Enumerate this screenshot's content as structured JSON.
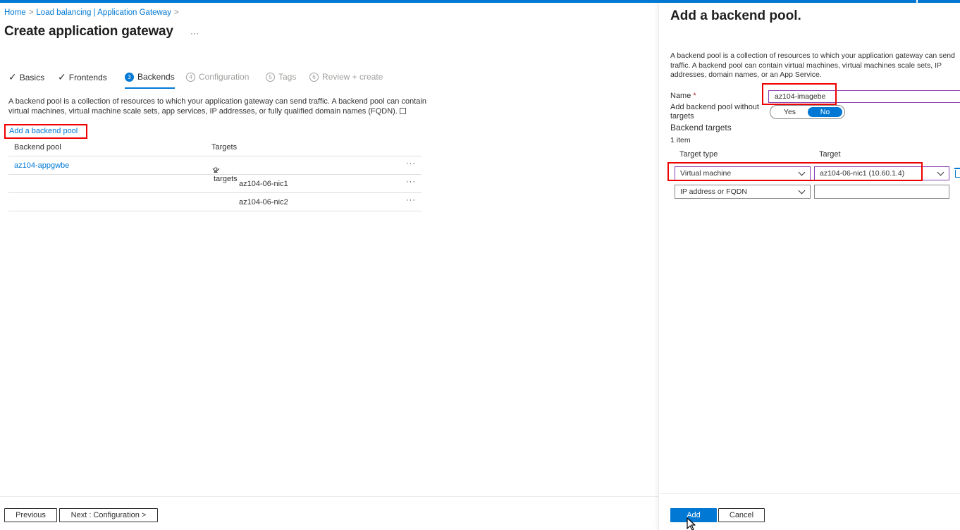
{
  "breadcrumb": {
    "home": "Home",
    "parent": "Load balancing | Application Gateway",
    "sep": ">"
  },
  "page": {
    "title": "Create application gateway",
    "more": "···"
  },
  "tabs": [
    {
      "label": "Basics",
      "state": "done"
    },
    {
      "label": "Frontends",
      "state": "done"
    },
    {
      "label": "Backends",
      "number": "3",
      "state": "active"
    },
    {
      "label": "Configuration",
      "number": "4",
      "state": "disabled"
    },
    {
      "label": "Tags",
      "number": "5",
      "state": "disabled"
    },
    {
      "label": "Review + create",
      "number": "6",
      "state": "disabled"
    }
  ],
  "main": {
    "description": "A backend pool is a collection of resources to which your application gateway can send traffic. A backend pool can contain virtual machines, virtual machine scale sets, app services, IP addresses, or fully qualified domain names (FQDN).",
    "add_pool_link": "Add a backend pool",
    "table": {
      "headers": [
        "Backend pool",
        "Targets"
      ],
      "rows": [
        {
          "pool": "az104-appgwbe",
          "targets": "2 targets"
        },
        {
          "pool": "",
          "targets": "az104-06-nic1"
        },
        {
          "pool": "",
          "targets": "az104-06-nic2"
        }
      ],
      "more_label": "···"
    }
  },
  "footer_left": {
    "previous": "Previous",
    "next": "Next : Configuration >"
  },
  "panel": {
    "title": "Add a backend pool.",
    "description": "A backend pool is a collection of resources to which your application gateway can send traffic. A backend pool can contain virtual machines, virtual machines scale sets, IP addresses, domain names, or an App Service.",
    "name_label": "Name",
    "required_mark": "*",
    "name_value": "az104-imagebe",
    "without_targets_label": "Add backend pool without targets",
    "toggle": {
      "yes": "Yes",
      "no": "No",
      "selected": "No"
    },
    "backend_targets_heading": "Backend targets",
    "item_count": "1 item",
    "col_target_type": "Target type",
    "col_target": "Target",
    "rows": [
      {
        "type": "Virtual machine",
        "target": "az104-06-nic1 (10.60.1.4)"
      },
      {
        "type": "IP address or FQDN",
        "target": ""
      }
    ]
  },
  "footer_right": {
    "add": "Add",
    "cancel": "Cancel"
  },
  "colors": {
    "accent": "#0078d4",
    "highlight": "#ee0000",
    "focus": "#8a3fb0"
  }
}
